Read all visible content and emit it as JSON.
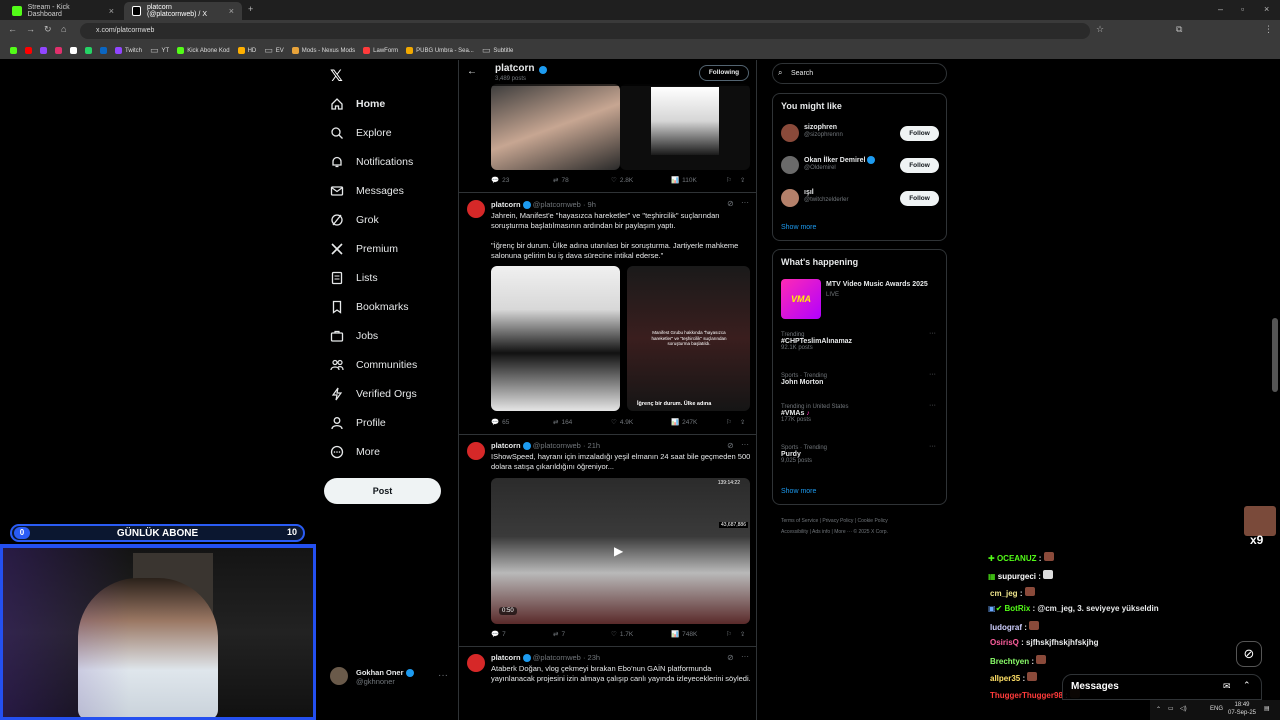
{
  "browser": {
    "tabs": [
      {
        "label": "Stream - Kick Dashboard",
        "favicon_color": "#53fc18"
      },
      {
        "label": "platcorn (@platcornweb) / X",
        "favicon_color": "#ffffff"
      }
    ],
    "url": "x.com/platcornweb",
    "bookmarks": [
      "Twitch",
      "YT",
      "Kick Abone Kod",
      "HD",
      "EV",
      "Mods - Nexus Mods",
      "LawForm",
      "PUBG Umbra - Sea...",
      "Subtitle"
    ]
  },
  "nav": {
    "items": [
      "Home",
      "Explore",
      "Notifications",
      "Messages",
      "Grok",
      "Premium",
      "Lists",
      "Bookmarks",
      "Jobs",
      "Communities",
      "Verified Orgs",
      "Profile",
      "More"
    ],
    "post_label": "Post",
    "account": {
      "name": "Gokhan Oner",
      "handle": "@gkhnoner"
    }
  },
  "profile_header": {
    "name": "platcorn",
    "posts": "3,489 posts",
    "following_label": "Following"
  },
  "tweets": [
    {
      "stats": {
        "replies": "23",
        "retweets": "78",
        "likes": "2.8K",
        "views": "110K"
      }
    },
    {
      "name": "platcorn",
      "handle": "@platcornweb",
      "time": "· 9h",
      "text1": "Jahrein, Manifest'e \"hayasızca hareketler\" ve \"teşhircilik\" suçlarından soruşturma başlatılmasının ardından bir paylaşım yaptı.",
      "text2": "\"İğrenç bir durum. Ülke adına utanılası bir soruşturma. Jartiyerle mahkeme salonuna gelirim bu iş dava sürecine intikal ederse.\"",
      "image_caption": "İğrenç bir durum. Ülke adına",
      "image_overlay": "Manifest Grubu hakkında \"hayasızca hareketler\" ve \"teşhircilik\" suçlarından soruşturma başlatıldı.",
      "stats": {
        "replies": "65",
        "retweets": "164",
        "likes": "4.9K",
        "views": "247K"
      }
    },
    {
      "name": "platcorn",
      "handle": "@platcornweb",
      "time": "· 21h",
      "text1": "IShowSpeed, hayranı için imzaladığı yeşil elmanın 24 saat bile geçmeden 500 dolara satışa çıkarıldığını öğreniyor...",
      "video_time": "0:50",
      "video_counter": "43,687,886",
      "video_clock": "139:14:22",
      "stats": {
        "replies": "7",
        "retweets": "7",
        "likes": "1.7K",
        "views": "748K"
      }
    },
    {
      "name": "platcorn",
      "handle": "@platcornweb",
      "time": "· 23h",
      "text1": "Ataberk Doğan, vlog çekmeyi bırakan Ebo'nun GAİN platformunda yayınlanacak projesini izin almaya çalışıp canlı yayında izleyeceklerini söyledi."
    }
  ],
  "right": {
    "search_placeholder": "Search",
    "you_might_like": {
      "title": "You might like",
      "users": [
        {
          "name": "sizophren",
          "handle": "@sizophrennn",
          "button": "Follow"
        },
        {
          "name": "Okan İlker Demirel",
          "handle": "@Oldemirel",
          "button": "Follow"
        },
        {
          "name": "ışıl",
          "handle": "@twitchzelderler",
          "button": "Follow"
        }
      ],
      "show_more": "Show more"
    },
    "happening": {
      "title": "What's happening",
      "event": {
        "name": "MTV Video Music Awards 2025",
        "status": "LIVE",
        "logo": "VMA"
      },
      "trends": [
        {
          "context": "Trending",
          "topic": "#CHPTeslimAlınamaz",
          "count": "92.1K posts"
        },
        {
          "context": "Sports · Trending",
          "topic": "John Morton",
          "count": ""
        },
        {
          "context": "Trending in United States",
          "topic": "#VMAs",
          "count": "177K posts"
        },
        {
          "context": "Sports · Trending",
          "topic": "Purdy",
          "count": "9,025 posts"
        }
      ],
      "show_more": "Show more"
    },
    "footer": [
      "Terms of Service",
      "Privacy Policy",
      "Cookie Policy",
      "Accessibility",
      "Ads info",
      "More ···",
      "© 2025 X Corp."
    ]
  },
  "overlay": {
    "abone_label": "GÜNLÜK ABONE",
    "abone_current": "0",
    "abone_goal": "10",
    "gift_count": "x9"
  },
  "chat": [
    {
      "user": "OCEANUZ",
      "msg": ":",
      "color": "#53fc18"
    },
    {
      "user": "supurgeci",
      "msg": ":",
      "color": "#ffffff"
    },
    {
      "user": "cm_jeg",
      "msg": ":",
      "color": "#f0e68c"
    },
    {
      "user": "BotRix",
      "msg": ": @cm_jeg, 3. seviyeye yükseldin",
      "color": "#53fc18"
    },
    {
      "user": "ludograf",
      "msg": ":",
      "color": "#d0d0ff"
    },
    {
      "user": "OsirisQ",
      "msg": ": sjfhskjfhskjhfskjhg",
      "color": "#ff5f9e"
    },
    {
      "user": "Brechtyen",
      "msg": ":",
      "color": "#8bff6a"
    },
    {
      "user": "allper35",
      "msg": ":",
      "color": "#ffe066"
    },
    {
      "user": "ThuggerThugger98",
      "msg": ":",
      "color": "#ff3b3b"
    }
  ],
  "messages_drawer": {
    "label": "Messages"
  },
  "taskbar": {
    "lang": "ENG",
    "time": "18:49",
    "date": "07-Sep-25"
  }
}
